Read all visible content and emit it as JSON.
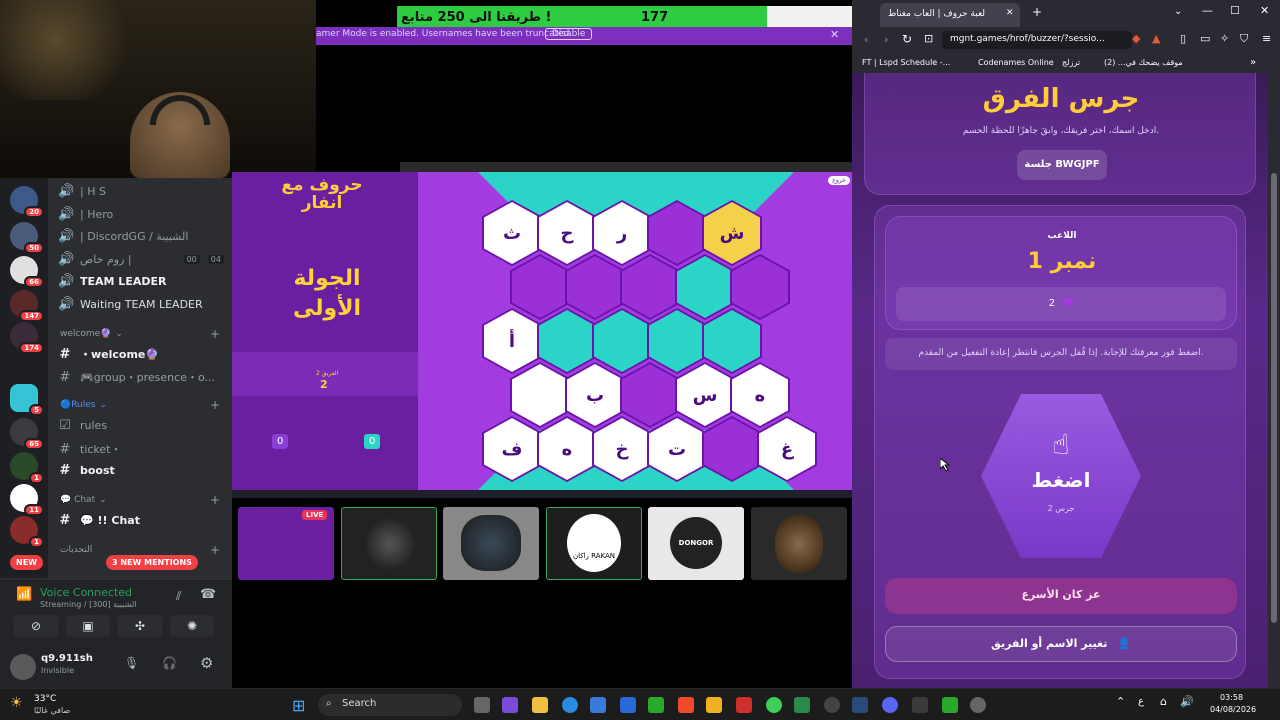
{
  "stream": {
    "goal_text": "طريقنا الى 250 متابع !",
    "current": "177",
    "target": "250",
    "progress_fraction": 0.72,
    "gamer_mode": "amer Mode is enabled. Usernames have been truncated.",
    "disable": "Disable",
    "close": "✕"
  },
  "game": {
    "logo": "حروف مع انفار",
    "round": "الجولة الأولى",
    "team_label": "الفريق 2",
    "team_score": "2",
    "score_a": "0",
    "score_b": "0",
    "score_a_idx": "1",
    "score_b_idx": "1",
    "corner_btn": "خروج",
    "hexes": [
      "ث",
      "ح",
      "ر",
      "",
      "ش",
      "",
      "",
      "",
      "",
      "",
      "أ",
      "",
      "",
      "",
      "",
      "",
      "ب",
      "",
      "س",
      "ه",
      "ف",
      "ه",
      "خ",
      "ت",
      "",
      "غ"
    ]
  },
  "thumbs": {
    "live": "LIVE",
    "t4": "راكان RAKAN",
    "t5": "DONGOR"
  },
  "discord": {
    "badges": [
      "20",
      "50",
      "66",
      "147",
      "174",
      "5",
      "65",
      "1",
      "11",
      "1"
    ],
    "channels": [
      {
        "icon": "🔊",
        "label": "| H S"
      },
      {
        "icon": "🔊",
        "label": "| Hero"
      },
      {
        "icon": "🔊",
        "label": "| DiscordGG / الشبيبة"
      },
      {
        "icon": "🔊",
        "label": "روم خاص |"
      },
      {
        "icon": "🔊",
        "label": "TEAM LEADER"
      },
      {
        "icon": "🔊",
        "label": "Waiting TEAM LEADER"
      }
    ],
    "room_counts": [
      "00",
      "04"
    ],
    "cat_welcome": "welcome🔮",
    "welcome": "・welcome🔮",
    "group": "🎮group・presence・o...",
    "cat_rules": "🔵Rules",
    "rules": "rules",
    "ticket": "ticket・",
    "boost": "boost",
    "cat_chat": "💬 Chat",
    "chat": "💬 !! Chat",
    "cat_misc": "التحديات",
    "new": "NEW",
    "mentions": "3 NEW MENTIONS",
    "voice_title": "Voice Connected",
    "voice_sub": "Streaming / [300] الشبيبة",
    "username": "q9.911sh",
    "status": "Invisible"
  },
  "browser": {
    "tab": "لعبة حروف | العاب مغناط",
    "url": "mgnt.games/hrof/buzzer/?sessio...",
    "bookmarks": [
      "FT | Lspd Schedule -...",
      "Codenames Online",
      "ترزلج",
      "موقف يضحك في... (2)"
    ]
  },
  "buzzer": {
    "title": "جرس الفرق",
    "subtitle": "ادخل اسمك، اختر فريقك، وابقَ جاهزًا للحظة الحسم.",
    "session": "جلسة BWGJPF",
    "player_label": "اللاعب",
    "player_name": "نمبر 1",
    "team": "2",
    "hint": "اضغط فور معرفتك للإجابة. إذا قُفل الجرس فانتظر إعادة التفعيل من المقدم.",
    "press": "اضغط",
    "bell": "جرس 2",
    "fastest": "عز كان الأسرع",
    "change": "تغيير الاسم أو الفريق"
  },
  "taskbar": {
    "temp": "33°C",
    "weather": "صافي غالبًا",
    "search": "Search",
    "lang": "ع",
    "time": "03:58",
    "date": "04/08/2026"
  }
}
